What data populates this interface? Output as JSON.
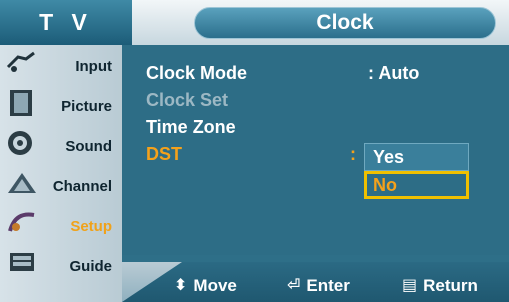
{
  "header": {
    "left_tab": "T V",
    "title": "Clock"
  },
  "sidebar": {
    "items": [
      {
        "label": "Input",
        "icon": "input-icon"
      },
      {
        "label": "Picture",
        "icon": "picture-icon"
      },
      {
        "label": "Sound",
        "icon": "sound-icon"
      },
      {
        "label": "Channel",
        "icon": "channel-icon"
      },
      {
        "label": "Setup",
        "icon": "setup-icon",
        "active": true
      },
      {
        "label": "Guide",
        "icon": "guide-icon"
      }
    ]
  },
  "menu": {
    "clock_mode": {
      "label": "Clock Mode",
      "value": ": Auto"
    },
    "clock_set": {
      "label": "Clock Set"
    },
    "time_zone": {
      "label": "Time Zone"
    },
    "dst": {
      "label": "DST",
      "colon": ":"
    }
  },
  "dropdown": {
    "options": [
      "Yes",
      "No"
    ],
    "selected_index": 1
  },
  "footer": {
    "move": "Move",
    "enter": "Enter",
    "return": "Return"
  },
  "colors": {
    "accent_orange": "#f4a11b",
    "selection_yellow": "#f0c000",
    "panel_teal": "#2d6d86"
  }
}
